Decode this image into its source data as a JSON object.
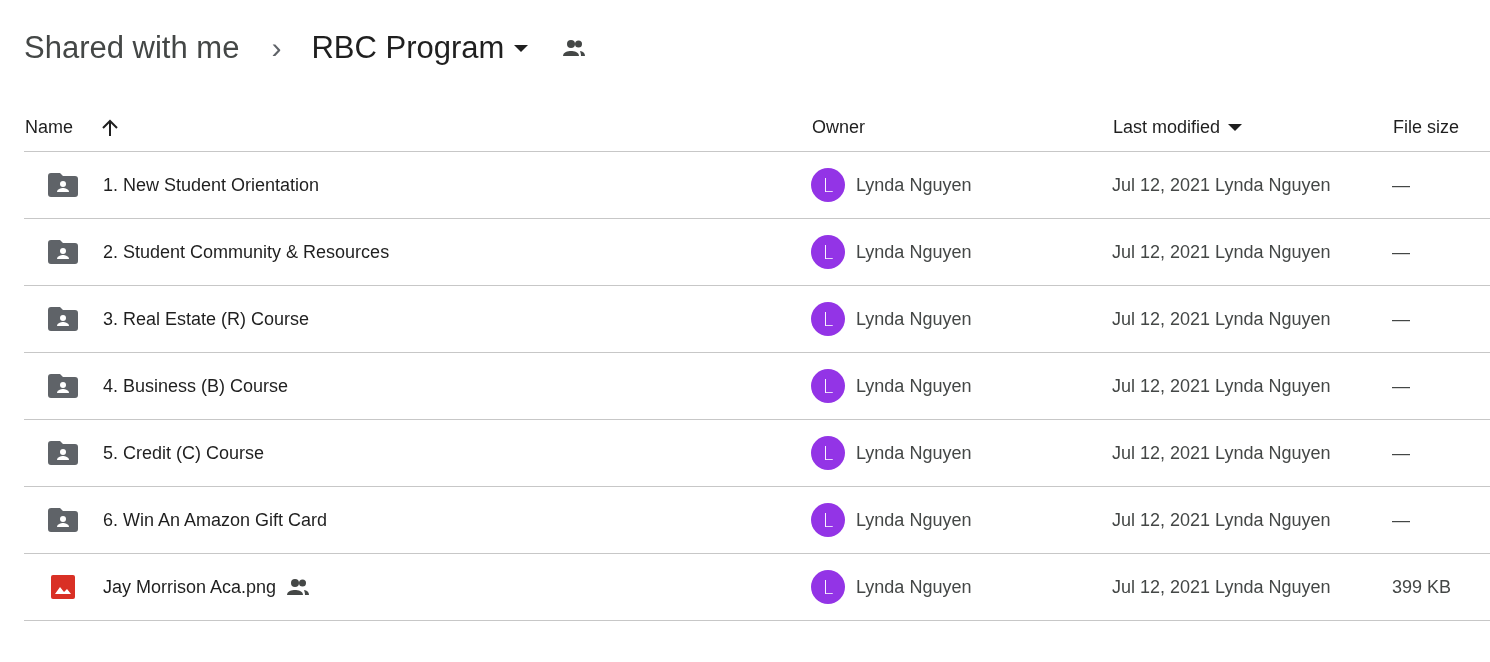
{
  "breadcrumb": {
    "parent": "Shared with me",
    "separator": "›",
    "current": "RBC Program"
  },
  "table": {
    "columns": [
      {
        "label": "Name",
        "sorted": true,
        "ascending": true
      },
      {
        "label": "Owner",
        "sorted": false
      },
      {
        "label": "Last modified",
        "sorted": true,
        "ascending": false
      },
      {
        "label": "File size",
        "sorted": false
      }
    ],
    "rows": [
      {
        "kind": "folder",
        "name": "1. New Student Orientation",
        "shared": false,
        "owner": {
          "initial": "L",
          "name": "Lynda Nguyen",
          "color": "#9334e6"
        },
        "modified": "Jul 12, 2021 Lynda Nguyen",
        "size": "—"
      },
      {
        "kind": "folder",
        "name": "2. Student Community & Resources",
        "shared": false,
        "owner": {
          "initial": "L",
          "name": "Lynda Nguyen",
          "color": "#9334e6"
        },
        "modified": "Jul 12, 2021 Lynda Nguyen",
        "size": "—"
      },
      {
        "kind": "folder",
        "name": "3. Real Estate (R) Course",
        "shared": false,
        "owner": {
          "initial": "L",
          "name": "Lynda Nguyen",
          "color": "#9334e6"
        },
        "modified": "Jul 12, 2021 Lynda Nguyen",
        "size": "—"
      },
      {
        "kind": "folder",
        "name": "4. Business (B) Course",
        "shared": false,
        "owner": {
          "initial": "L",
          "name": "Lynda Nguyen",
          "color": "#9334e6"
        },
        "modified": "Jul 12, 2021 Lynda Nguyen",
        "size": "—"
      },
      {
        "kind": "folder",
        "name": "5. Credit (C) Course",
        "shared": false,
        "owner": {
          "initial": "L",
          "name": "Lynda Nguyen",
          "color": "#9334e6"
        },
        "modified": "Jul 12, 2021 Lynda Nguyen",
        "size": "—"
      },
      {
        "kind": "folder",
        "name": "6. Win An Amazon Gift Card",
        "shared": false,
        "owner": {
          "initial": "L",
          "name": "Lynda Nguyen",
          "color": "#9334e6"
        },
        "modified": "Jul 12, 2021 Lynda Nguyen",
        "size": "—"
      },
      {
        "kind": "image",
        "name": "Jay Morrison Aca.png",
        "shared": true,
        "owner": {
          "initial": "L",
          "name": "Lynda Nguyen",
          "color": "#9334e6"
        },
        "modified": "Jul 12, 2021 Lynda Nguyen",
        "size": "399 KB"
      }
    ]
  }
}
